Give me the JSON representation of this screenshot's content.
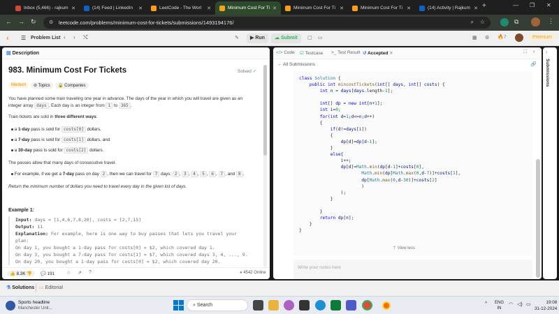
{
  "browser": {
    "tabs": [
      {
        "label": "Inbox (5,466) - rajkum",
        "color": "#d44638"
      },
      {
        "label": "(14) Feed | LinkedIn",
        "color": "#0a66c2"
      },
      {
        "label": "LeetCode - The Worl",
        "color": "#f89f1b"
      },
      {
        "label": "Minimum Cost For Ti",
        "color": "#f89f1b"
      },
      {
        "label": "Minimum Cost For Ti",
        "color": "#f89f1b"
      },
      {
        "label": "Minimum Cost For Ti",
        "color": "#f89f1b"
      },
      {
        "label": "(14) Activity | Rajkum",
        "color": "#0a66c2"
      }
    ],
    "url": "leetcode.com/problems/minimum-cost-for-tickets/submissions/1493194176/"
  },
  "header": {
    "problem_list": "Problem List",
    "run": "Run",
    "submit": "Submit",
    "streak": "7",
    "premium": "Premium"
  },
  "left": {
    "tab_description": "Description",
    "title": "983. Minimum Cost For Tickets",
    "solved": "Solved",
    "difficulty": "Medium",
    "tag_topics": "Topics",
    "tag_companies": "Companies",
    "p1a": "You have planned some train traveling one year in advance. The days of the year in which you will travel are given as an",
    "p1b": "integer array",
    "p1b_code": "days",
    "p1c": ". Each day is an integer from",
    "p1c_code1": "1",
    "p1d": "to",
    "p1d_code2": "365",
    "p2a": "Train tickets are sold in",
    "p2b": "three different ways",
    "bullets": [
      {
        "pre": "a ",
        "bold": "1-day",
        "mid": " pass is sold for ",
        "code": "costs[0]",
        "post": " dollars,"
      },
      {
        "pre": "a ",
        "bold": "7-day",
        "mid": " pass is sold for ",
        "code": "costs[1]",
        "post": " dollars, and"
      },
      {
        "pre": "a ",
        "bold": "30-day",
        "mid": " pass is sold for ",
        "code": "costs[2]",
        "post": " dollars."
      }
    ],
    "p3": "The passes allow that many days of consecutive travel.",
    "example_bullet": {
      "pre": "For example, if we get a ",
      "bold": "7-day",
      "mid": " pass on day ",
      "code": "2",
      "mid2": ", then we can travel for ",
      "codes": [
        "7",
        "2",
        "3",
        "4",
        "5",
        "6",
        "7"
      ],
      "and": "and",
      "last": "8",
      "end": "."
    },
    "p4": "Return the minimum number of dollars you need to travel every day in the given list of days.",
    "example_title": "Example 1:",
    "ex_input_label": "Input:",
    "ex_input": "days = [1,4,6,7,8,20], costs = [2,7,15]",
    "ex_output_label": "Output:",
    "ex_output": "11",
    "ex_expl_label": "Explanation:",
    "ex_expl": "For example, here is one way to buy passes that lets you travel your",
    "ex_lines": [
      "plan:",
      "On day 1, you bought a 1-day pass for costs[0] = $2, which covered day 1.",
      "On day 3, you bought a 7-day pass for costs[1] = $7, which covered days 3, 4, ..., 9.",
      "On day 20, you bought a 1-day pass for costs[0] = $2, which covered day 20."
    ],
    "likes": "8.3K",
    "comments": "191",
    "online": "4542 Online"
  },
  "right": {
    "tab_code": "Code",
    "tab_testcase": "Testcase",
    "tab_result": "Test Result",
    "tab_accepted": "Accepted",
    "all_submissions": "All Submissions",
    "view_less": "View less",
    "notes_placeholder": "Write your notes here",
    "side_label": "Submissions"
  },
  "bottom": {
    "solutions": "Solutions",
    "editorial": "Editorial"
  },
  "taskbar": {
    "news_title": "Sports headline",
    "news_sub": "Manchester Unit...",
    "search": "Search",
    "lang1": "ENG",
    "lang2": "IN",
    "time": "19:08",
    "date": "31-12-2024"
  }
}
